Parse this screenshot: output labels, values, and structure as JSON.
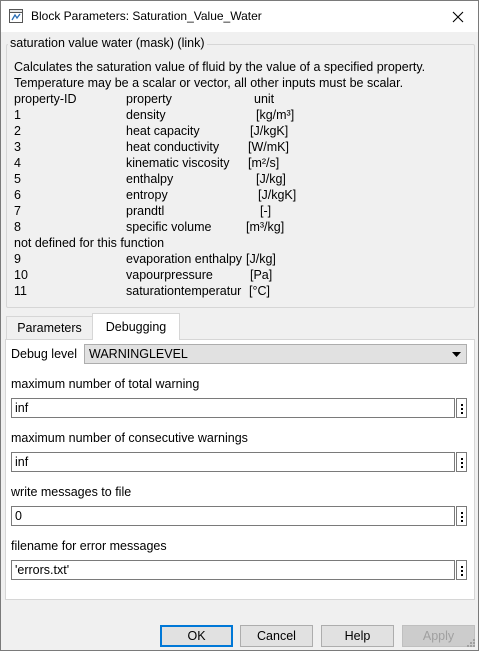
{
  "window": {
    "title": "Block Parameters: Saturation_Value_Water"
  },
  "description": {
    "legend": "saturation value water (mask) (link)",
    "line1": "Calculates the saturation value of fluid by the value of a specified property.",
    "line2": "Temperature may be a scalar or vector, all other inputs must be scalar.",
    "header": {
      "id": "property-ID",
      "property": "property",
      "unit": "unit"
    },
    "rows": [
      {
        "id": "1",
        "property": "density",
        "unit": "[kg/m³]"
      },
      {
        "id": "2",
        "property": "heat capacity",
        "unit": "[J/kgK]"
      },
      {
        "id": "3",
        "property": "heat conductivity",
        "unit": "[W/mK]"
      },
      {
        "id": "4",
        "property": "kinematic viscosity",
        "unit": "[m²/s]"
      },
      {
        "id": "5",
        "property": "enthalpy",
        "unit": "[J/kg]"
      },
      {
        "id": "6",
        "property": "entropy",
        "unit": "[J/kgK]"
      },
      {
        "id": "7",
        "property": "prandtl",
        "unit": "[-]"
      },
      {
        "id": "8",
        "property": "specific volume",
        "unit": "[m³/kg]"
      }
    ],
    "not_defined": "not defined for this function",
    "rows2": [
      {
        "id": "9",
        "property": "evaporation  enthalpy",
        "unit": "[J/kg]"
      },
      {
        "id": "10",
        "property": "vapourpressure",
        "unit": "[Pa]"
      },
      {
        "id": "11",
        "property": "saturationtemperatur",
        "unit": "[°C]"
      }
    ]
  },
  "tabs": [
    {
      "label": "Parameters",
      "active": false
    },
    {
      "label": "Debugging",
      "active": true
    }
  ],
  "debugging": {
    "debug_level_label": "Debug level",
    "debug_level_value": "WARNINGLEVEL",
    "max_total_label": "maximum number of total warning",
    "max_total_value": "inf",
    "max_consec_label": "maximum number of consecutive warnings",
    "max_consec_value": "inf",
    "write_file_label": "write messages to file",
    "write_file_value": "0",
    "filename_label": "filename for error messages",
    "filename_value": "'errors.txt'"
  },
  "buttons": {
    "ok": "OK",
    "cancel": "Cancel",
    "help": "Help",
    "apply": "Apply"
  },
  "colors": {
    "accent": "#0078d7",
    "window_bg": "#f0f0f0",
    "panel_bg": "#ffffff"
  }
}
